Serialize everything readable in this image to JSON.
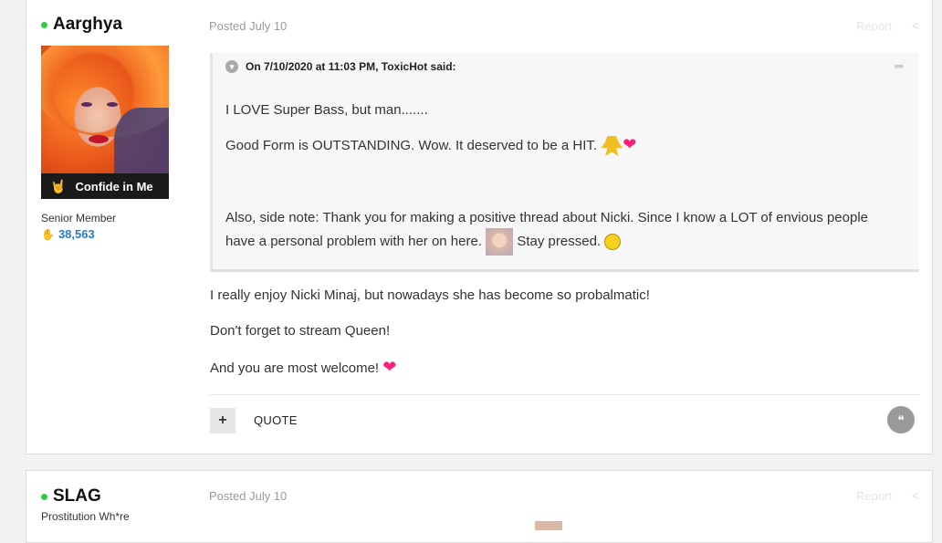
{
  "posts": [
    {
      "author": "Aarghya",
      "badge": "Confide in Me",
      "member_title": "Senior Member",
      "reputation": "38,563",
      "posted": "Posted July 10",
      "report": "Report",
      "quote": {
        "header": "On 7/10/2020 at 11:03 PM, ToxicHot said:",
        "lines": [
          "I LOVE Super Bass, but man.......",
          "Good Form is OUTSTANDING. Wow. It deserved to be a HIT.",
          "Also, side note: Thank you for making a positive thread about Nicki. Since I know a LOT of envious people",
          "have a personal problem with her on here.",
          "Stay pressed."
        ]
      },
      "body": [
        "I really enjoy Nicki Minaj, but nowadays she has become so probalmatic!",
        "Don't forget to stream Queen!",
        "And you are most welcome!"
      ],
      "actions": {
        "plus": "+",
        "quote": "QUOTE"
      }
    },
    {
      "author": "SLAG",
      "member_title": "Prostitution Wh*re",
      "posted": "Posted July 10",
      "report": "Report"
    }
  ],
  "colors": {
    "online": "#2ecc40",
    "rep": "#2a7ac8",
    "heart": "#ff1f7a"
  }
}
